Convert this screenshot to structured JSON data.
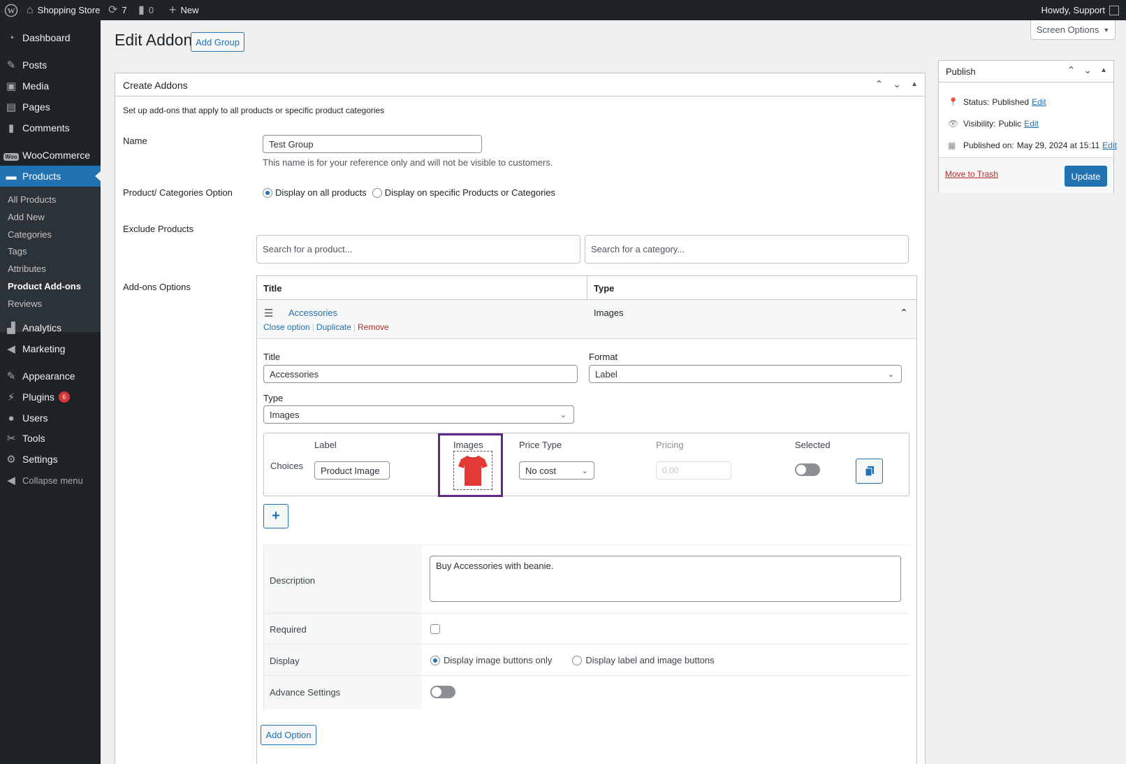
{
  "adminbar": {
    "site_name": "Shopping Store",
    "updates_count": "7",
    "comments_count": "0",
    "new_label": "New",
    "howdy": "Howdy, Support"
  },
  "screen_options": "Screen Options",
  "sidebar": {
    "items": [
      {
        "label": "Dashboard"
      },
      {
        "label": "Posts"
      },
      {
        "label": "Media"
      },
      {
        "label": "Pages"
      },
      {
        "label": "Comments"
      },
      {
        "label": "WooCommerce"
      },
      {
        "label": "Products"
      },
      {
        "label": "Analytics"
      },
      {
        "label": "Marketing"
      },
      {
        "label": "Appearance"
      },
      {
        "label": "Plugins",
        "badge": "6"
      },
      {
        "label": "Users"
      },
      {
        "label": "Tools"
      },
      {
        "label": "Settings"
      },
      {
        "label": "Collapse menu"
      }
    ],
    "submenu": [
      "All Products",
      "Add New",
      "Categories",
      "Tags",
      "Attributes",
      "Product Add-ons",
      "Reviews"
    ]
  },
  "page": {
    "title": "Edit Addon",
    "add_group": "Add Group"
  },
  "create_addons": {
    "header": "Create Addons",
    "intro": "Set up add-ons that apply to all products or specific product categories",
    "name_label": "Name",
    "name_value": "Test Group",
    "name_hint": "This name is for your reference only and will not be visible to customers.",
    "pc_option_label": "Product/ Categories Option",
    "pc_option_all": "Display on all products",
    "pc_option_specific": "Display on specific Products or Categories",
    "exclude_label": "Exclude Products",
    "search_product_placeholder": "Search for a product...",
    "search_category_placeholder": "Search for a category...",
    "addons_label": "Add-ons Options",
    "col_title": "Title",
    "col_type": "Type",
    "addon": {
      "title": "Accessories",
      "type": "Images",
      "close_option": "Close option",
      "duplicate": "Duplicate",
      "remove": "Remove",
      "field_title_label": "Title",
      "field_title_value": "Accessories",
      "format_label": "Format",
      "format_value": "Label",
      "type_label": "Type",
      "type_value": "Images",
      "choices_label": "Choices",
      "choice_col_label": "Label",
      "choice_col_images": "Images",
      "choice_col_price_type": "Price Type",
      "choice_col_pricing": "Pricing",
      "choice_col_selected": "Selected",
      "choice_label_value": "Product Image",
      "price_type_value": "No cost",
      "pricing_placeholder": "0.00",
      "description_label": "Description",
      "description_value": "Buy Accessories with beanie.",
      "required_label": "Required",
      "display_label": "Display",
      "display_image_only": "Display image buttons only",
      "display_label_and_image": "Display label and image buttons",
      "advance_label": "Advance Settings",
      "add_option": "Add Option"
    }
  },
  "publish": {
    "header": "Publish",
    "status_label": "Status:",
    "status_value": "Published",
    "visibility_label": "Visibility:",
    "visibility_value": "Public",
    "published_label": "Published on:",
    "published_value": "May 29, 2024 at 15:11",
    "edit": "Edit",
    "trash": "Move to Trash",
    "update": "Update"
  },
  "colors": {
    "accent": "#2271b1",
    "sidebar_bg": "#1d2327",
    "highlight_border": "#5b2a86",
    "shirt": "#e53935"
  }
}
